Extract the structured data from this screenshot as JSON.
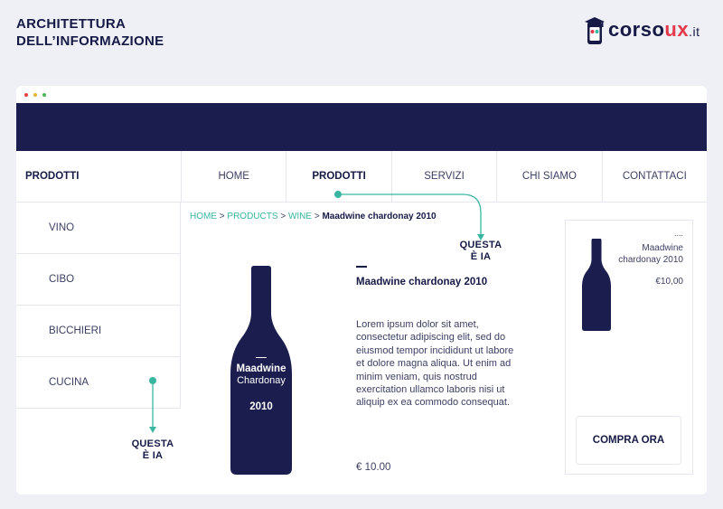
{
  "slide": {
    "title_line1": "ARCHITETTURA",
    "title_line2": "DELL’INFORMAZIONE"
  },
  "brand": {
    "name_prefix": "corso",
    "name_ux": "ux",
    "name_tld": ".it",
    "accent_color": "#e5384a"
  },
  "window": {
    "header_color": "#1a1d4d",
    "traffic_lights": [
      "#e2453c",
      "#e3b332",
      "#47b556"
    ]
  },
  "sidebar": {
    "heading": "PRODOTTI",
    "items": [
      {
        "label": "VINO"
      },
      {
        "label": "CIBO"
      },
      {
        "label": "BICCHIERI"
      },
      {
        "label": "CUCINA"
      }
    ]
  },
  "nav": {
    "items": [
      {
        "label": "HOME",
        "active": false
      },
      {
        "label": "PRODOTTI",
        "active": true
      },
      {
        "label": "SERVIZI",
        "active": false
      },
      {
        "label": "CHI SIAMO",
        "active": false
      },
      {
        "label": "CONTATTACI",
        "active": false
      }
    ]
  },
  "breadcrumb": {
    "home": "HOME",
    "products": "PRODUCTS",
    "category": "WINE",
    "current": "Maadwine chardonay 2010",
    "separator": ">"
  },
  "annotations": {
    "top_line1": "QUESTA",
    "top_line2": "È IA",
    "bottom_line1": "QUESTA",
    "bottom_line2": "È IA",
    "color": "#3ab6a0"
  },
  "product": {
    "dash": "—",
    "title": "Maadwine chardonay 2010",
    "description": "Lorem ipsum dolor sit amet, consectetur adipiscing elit, sed do eiusmod tempor incididunt ut labore et dolore magna aliqua. Ut enim ad minim veniam, quis nostrud exercitation ullamco laboris nisi ut aliquip ex ea commodo consequat.",
    "price": "€ 10.00",
    "bottle_label": {
      "name": "Maadwine",
      "variety": "Chardonay",
      "year": "2010"
    }
  },
  "aside": {
    "dots": "....",
    "name": "Maadwine chardonay 2010",
    "price": "€10,00",
    "buy_label": "COMPRA ORA"
  }
}
